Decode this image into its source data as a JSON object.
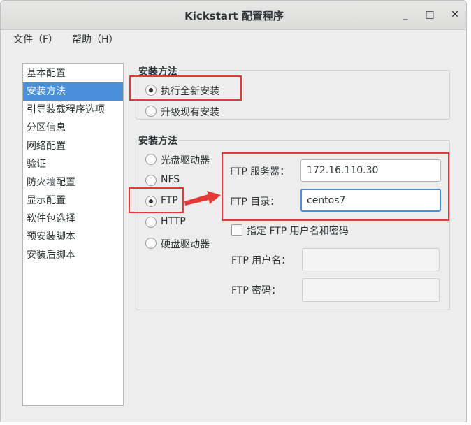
{
  "window": {
    "title": "Kickstart 配置程序",
    "controls": {
      "minimize": "_",
      "maximize": "□",
      "close": "✕"
    }
  },
  "menu": {
    "file": "文件（F）",
    "help": "帮助（H）"
  },
  "sidebar": {
    "selected_index": 1,
    "items": [
      "基本配置",
      "安装方法",
      "引导装载程序选项",
      "分区信息",
      "网络配置",
      "验证",
      "防火墙配置",
      "显示配置",
      "软件包选择",
      "预安装脚本",
      "安装后脚本"
    ]
  },
  "install_type": {
    "title": "安装方法",
    "options": [
      {
        "label": "执行全新安装",
        "checked": true
      },
      {
        "label": "升级现有安装",
        "checked": false
      }
    ]
  },
  "install_method": {
    "title": "安装方法",
    "options": [
      {
        "label": "光盘驱动器",
        "checked": false
      },
      {
        "label": "NFS",
        "checked": false
      },
      {
        "label": "FTP",
        "checked": true
      },
      {
        "label": "HTTP",
        "checked": false
      },
      {
        "label": "硬盘驱动器",
        "checked": false
      }
    ]
  },
  "ftp": {
    "server_label": "FTP 服务器：",
    "server_value": "172.16.110.30",
    "dir_label": "FTP 目录：",
    "dir_value": "centos7",
    "specify_label": "指定 FTP 用户名和密码",
    "specify_checked": false,
    "user_label": "FTP 用户名：",
    "user_value": "",
    "password_label": "FTP 密码：",
    "password_value": ""
  },
  "annotation": {
    "color": "#e53935"
  }
}
